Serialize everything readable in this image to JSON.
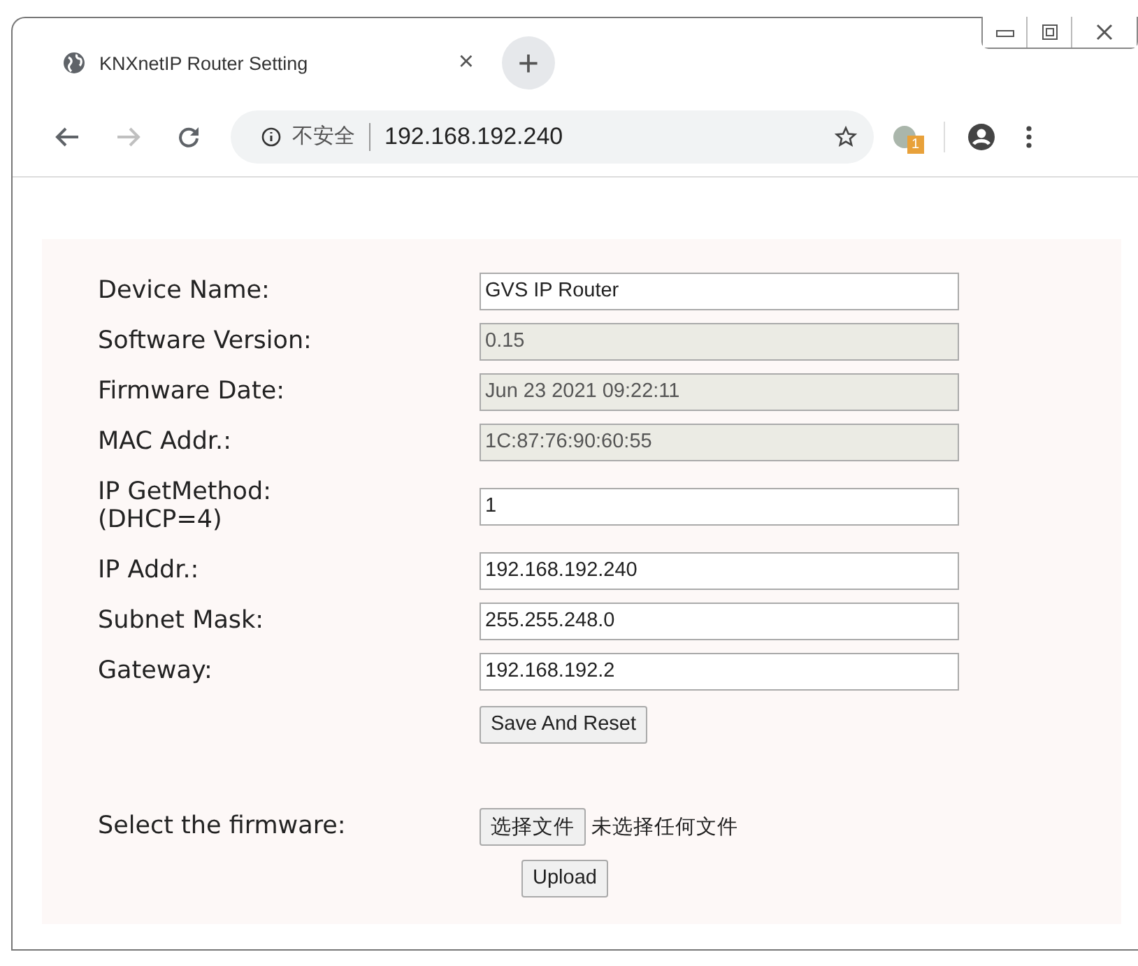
{
  "browser": {
    "tab": {
      "title": "KNXnetIP Router Setting",
      "close": "×"
    },
    "new_tab": "+",
    "security_label": "不安全",
    "url": "192.168.192.240",
    "extension_badge": "1"
  },
  "fields": [
    {
      "label": "Device Name:",
      "value": "GVS IP Router",
      "disabled": false
    },
    {
      "label": "Software Version:",
      "value": "0.15",
      "disabled": true
    },
    {
      "label": "Firmware Date:",
      "value": "Jun 23 2021 09:22:11",
      "disabled": true
    },
    {
      "label": "MAC Addr.:",
      "value": "1C:87:76:90:60:55",
      "disabled": true
    },
    {
      "label": "IP GetMethod: (DHCP=4)",
      "value": "1",
      "disabled": false
    },
    {
      "label": "IP Addr.:",
      "value": "192.168.192.240",
      "disabled": false
    },
    {
      "label": "Subnet Mask:",
      "value": "255.255.248.0",
      "disabled": false
    },
    {
      "label": "Gateway:",
      "value": "192.168.192.2",
      "disabled": false
    }
  ],
  "save_button": "Save And Reset",
  "firmware": {
    "label": "Select the firmware:",
    "choose_button": "选择文件",
    "file_status": "未选择任何文件",
    "upload_button": "Upload"
  }
}
